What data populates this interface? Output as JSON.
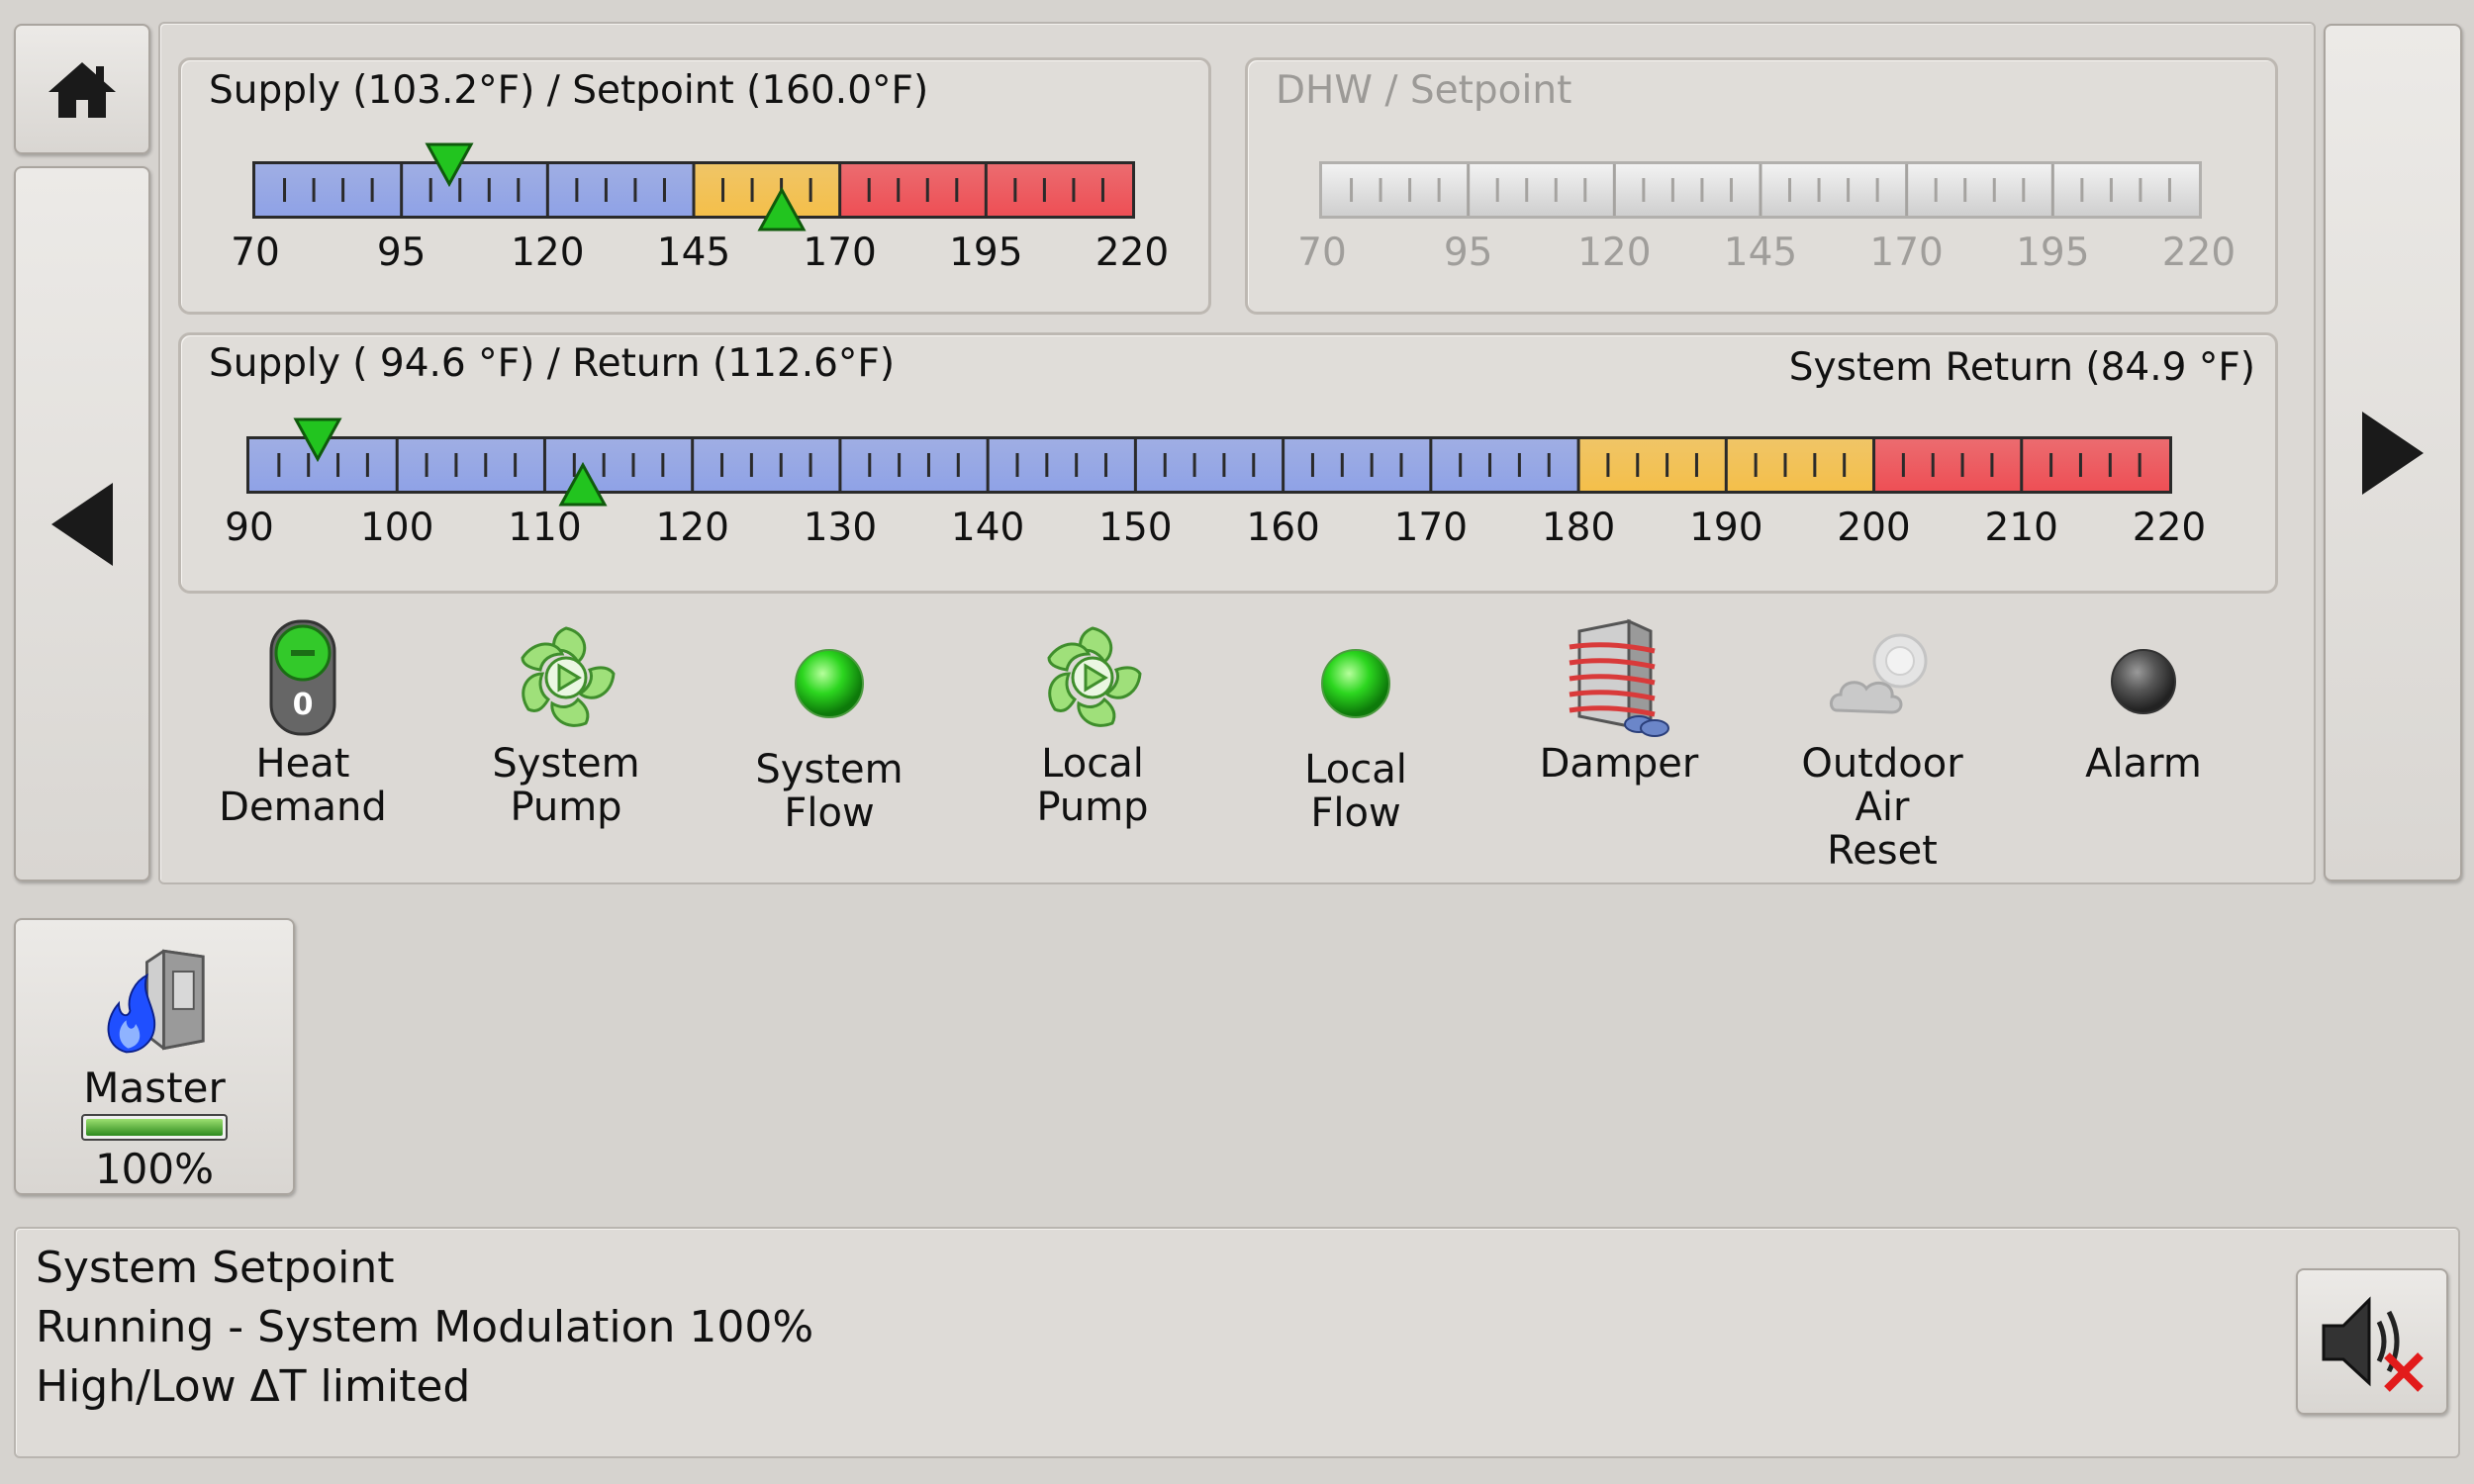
{
  "nav": {
    "home_icon": "home-icon",
    "prev_icon": "triangle-left-icon",
    "next_icon": "triangle-right-icon"
  },
  "gauge_supply_setpoint": {
    "title": "Supply (103.2°F) / Setpoint (160.0°F)",
    "scale_labels": [
      "70",
      "95",
      "120",
      "145",
      "170",
      "195",
      "220"
    ],
    "range": [
      70,
      220
    ],
    "zones": [
      {
        "from": 70,
        "to": 145,
        "color": "#8fa2e6"
      },
      {
        "from": 145,
        "to": 170,
        "color": "#f4bf4a"
      },
      {
        "from": 170,
        "to": 220,
        "color": "#ee4f55"
      }
    ],
    "supply_marker": 103.2,
    "setpoint_marker": 160.0
  },
  "gauge_dhw": {
    "title": "DHW / Setpoint",
    "scale_labels": [
      "70",
      "95",
      "120",
      "145",
      "170",
      "195",
      "220"
    ],
    "range": [
      70,
      220
    ]
  },
  "gauge_supply_return": {
    "title": "Supply ( 94.6 °F) / Return (112.6°F)",
    "right_title": "System Return (84.9 °F)",
    "scale_labels": [
      "90",
      "100",
      "110",
      "120",
      "130",
      "140",
      "150",
      "160",
      "170",
      "180",
      "190",
      "200",
      "210",
      "220"
    ],
    "range": [
      90,
      220
    ],
    "zones": [
      {
        "from": 90,
        "to": 180,
        "color": "#8fa2e6"
      },
      {
        "from": 180,
        "to": 200,
        "color": "#f4bf4a"
      },
      {
        "from": 200,
        "to": 220,
        "color": "#ee4f55"
      }
    ],
    "supply_marker": 94.6,
    "return_marker": 112.6
  },
  "status_icons": [
    {
      "label": "Heat\nDemand",
      "icon": "toggle-switch-icon"
    },
    {
      "label": "System\nPump",
      "icon": "pump-icon"
    },
    {
      "label": "System\nFlow",
      "icon": "green-light-icon"
    },
    {
      "label": "Local\nPump",
      "icon": "pump-icon"
    },
    {
      "label": "Local\nFlow",
      "icon": "green-light-icon"
    },
    {
      "label": "Damper",
      "icon": "damper-icon"
    },
    {
      "label": "Outdoor Air\nReset",
      "icon": "outdoor-air-icon"
    },
    {
      "label": "Alarm",
      "icon": "alarm-light-icon"
    }
  ],
  "heat_demand_switch_text": "0",
  "master": {
    "label": "Master",
    "percent_text": "100%",
    "modulation": 1.0
  },
  "status_lines": {
    "line1": "System Setpoint",
    "line2": "Running - System Modulation 100%",
    "line3": "High/Low ΔT limited"
  },
  "colors": {
    "green": "#22c41f",
    "blue_zone": "#8fa2e6",
    "yellow_zone": "#f4bf4a",
    "red_zone": "#ee4f55"
  }
}
